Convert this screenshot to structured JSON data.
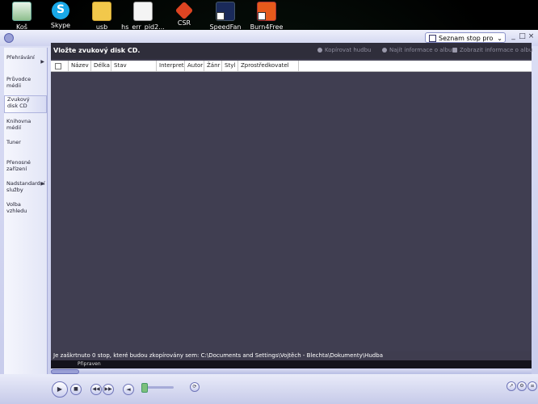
{
  "desktop": {
    "icons": [
      {
        "label": "Koš",
        "icon": "recycle-bin-icon"
      },
      {
        "label": "Skype",
        "icon": "skype-icon"
      },
      {
        "label": "usb",
        "icon": "folder-icon"
      },
      {
        "label": "hs_err_pid2...",
        "icon": "text-document-icon"
      },
      {
        "label": "CSR",
        "icon": "csr-shortcut-icon"
      },
      {
        "label": "SpeedFan",
        "icon": "speedfan-shortcut-icon"
      },
      {
        "label": "Burn4Free",
        "icon": "burn4free-shortcut-icon"
      }
    ]
  },
  "player": {
    "playlist_selector": "Seznam stop pro kopíro",
    "taskbar": [
      {
        "label": "Přehrávání",
        "has_submenu": true
      },
      {
        "label": "Průvodce médii",
        "has_submenu": false
      },
      {
        "label": "Zvukový disk CD",
        "has_submenu": false,
        "active": true
      },
      {
        "label": "Knihovna médií",
        "has_submenu": false
      },
      {
        "label": "Tuner",
        "has_submenu": false
      },
      {
        "label": "Přenosné zařízení",
        "has_submenu": false
      },
      {
        "label": "Nadstandardní služby",
        "has_submenu": true
      },
      {
        "label": "Volba vzhledu",
        "has_submenu": false
      }
    ],
    "content": {
      "title": "Vložte zvukový disk CD.",
      "toolbar": {
        "copy": "Kopírovat hudbu",
        "find_album": "Najít informace o albu",
        "show_album": "Zobrazit informace o albu"
      },
      "columns": [
        "Název",
        "Délka",
        "Stav kopírování",
        "Interpret",
        "Autor",
        "Žánr",
        "Styl",
        "Zprostředkovatel dat"
      ],
      "status_message": "Je zaškrtnuto 0 stop, které budou zkopírovány sem: C:\\Documents and Settings\\Vojtěch - Blechta\\Dokumenty\\Hudba"
    },
    "status_bar": {
      "state": "Připraven"
    }
  },
  "colors": {
    "content_bg": "#3f3d4f",
    "frame": "#c7cbeb",
    "accent": "#6a70b8"
  }
}
